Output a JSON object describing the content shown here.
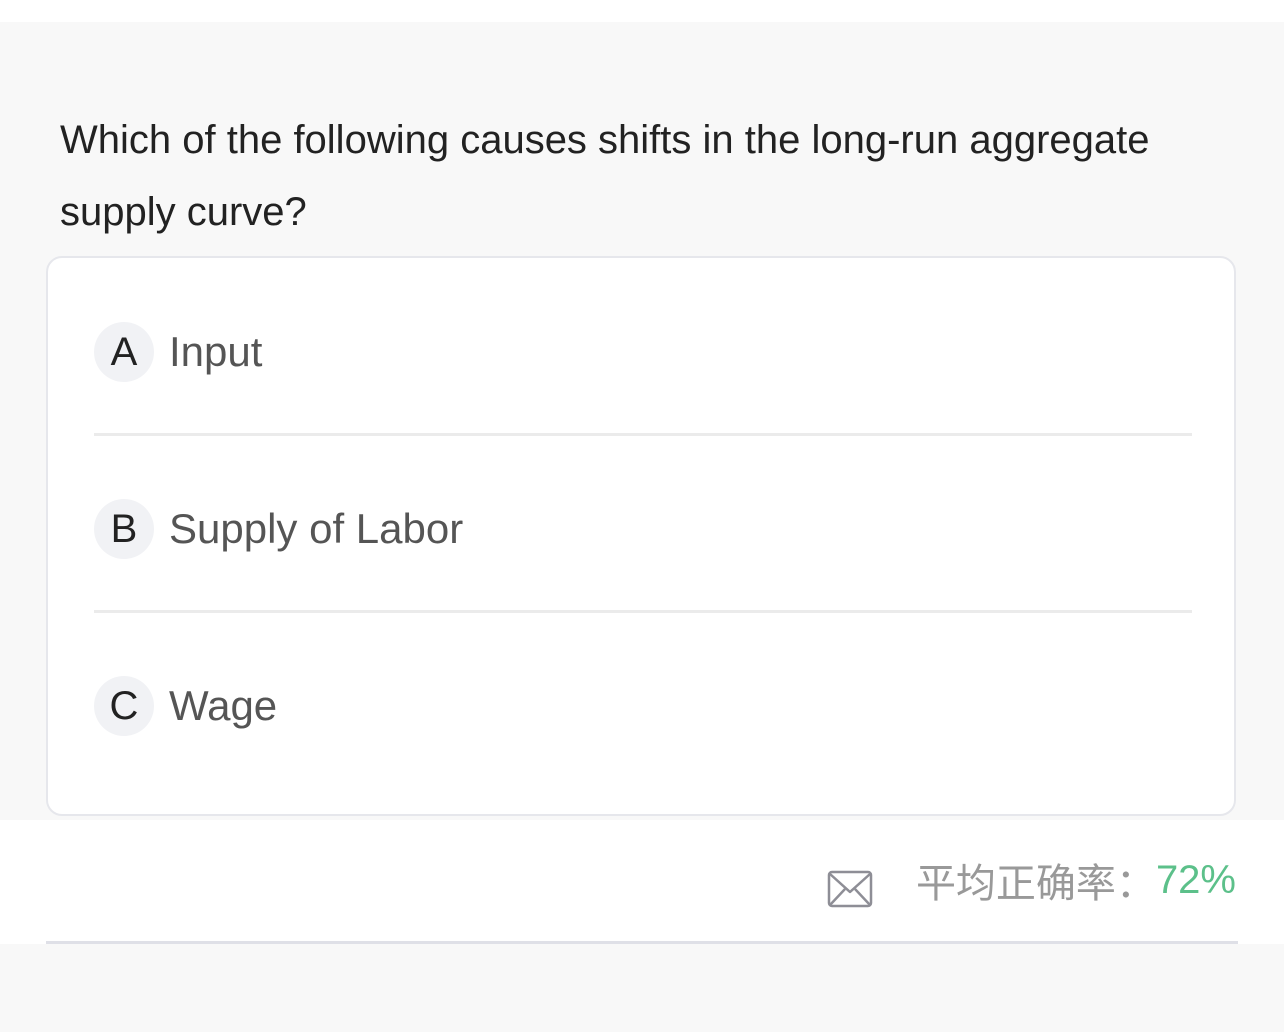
{
  "question": {
    "text": "Which of the following causes shifts in the long-run aggregate supply curve?"
  },
  "options": [
    {
      "letter": "A",
      "label": "Input"
    },
    {
      "letter": "B",
      "label": "Supply of Labor"
    },
    {
      "letter": "C",
      "label": "Wage"
    }
  ],
  "footer": {
    "mail_icon": "mail-icon",
    "accuracy_label": "平均正确率：",
    "accuracy_value": "72%",
    "accuracy_color": "#5cc08a"
  }
}
